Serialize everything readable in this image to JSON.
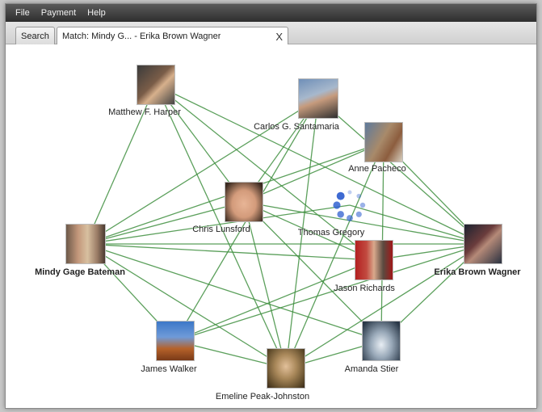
{
  "menu": {
    "items": [
      "File",
      "Payment",
      "Help"
    ]
  },
  "tabs": {
    "search_label": "Search",
    "match_label": "Match: Mindy G... - Erika Brown Wagner",
    "close_glyph": "X"
  },
  "graph": {
    "nodes": {
      "matthew": {
        "label": "Matthew F. Harper"
      },
      "carlos": {
        "label": "Carlos G. Santamaria"
      },
      "anne": {
        "label": "Anne Pacheco"
      },
      "chris": {
        "label": "Chris Lunsford"
      },
      "thomas": {
        "label": "Thomas Gregory"
      },
      "mindy": {
        "label": "Mindy Gage Bateman"
      },
      "erika": {
        "label": "Erika Brown Wagner"
      },
      "jason": {
        "label": "Jason Richards"
      },
      "james": {
        "label": "James Walker"
      },
      "amanda": {
        "label": "Amanda Stier"
      },
      "emeline": {
        "label": "Emeline Peak-Johnston"
      }
    },
    "edge_color": "#3f8f3f",
    "spinner_color": "#2f5fcf"
  }
}
